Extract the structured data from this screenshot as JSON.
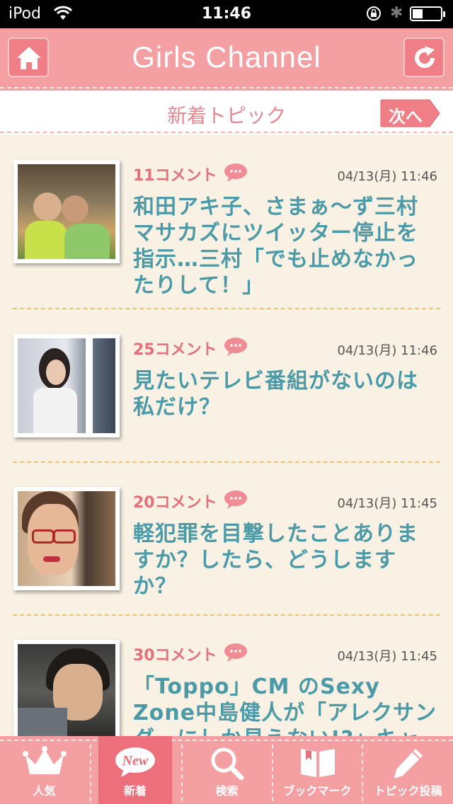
{
  "status_bar": {
    "carrier": "iPod",
    "time": "11:46"
  },
  "header": {
    "title": "Girls Channel"
  },
  "subheader": {
    "label": "新着トピック",
    "next_label": "次へ"
  },
  "topics": [
    {
      "comments": "11コメント",
      "date": "04/13(月) 11:46",
      "title": "和田アキ子、さまぁ〜ず三村マサカズにツイッター停止を指示…三村「でも止めなかったりして！」"
    },
    {
      "comments": "25コメント",
      "date": "04/13(月) 11:46",
      "title": "見たいテレビ番組がないのは私だけ？"
    },
    {
      "comments": "20コメント",
      "date": "04/13(月) 11:45",
      "title": "軽犯罪を目撃したことありますか？したら、どうしますか？"
    },
    {
      "comments": "30コメント",
      "date": "04/13(月) 11:45",
      "title": "「Toppo」CM のSexy Zone中島健人が「アレクサンダーにしか見えない!?」キャラかぶり"
    }
  ],
  "tabbar": {
    "tabs": [
      {
        "label": "人気",
        "icon": "crown-icon"
      },
      {
        "label": "新着",
        "icon": "new-badge-icon",
        "badge": "New",
        "active": true
      },
      {
        "label": "検索",
        "icon": "search-icon"
      },
      {
        "label": "ブックマーク",
        "icon": "book-icon"
      },
      {
        "label": "トピック投稿",
        "icon": "pencil-icon"
      }
    ]
  },
  "colors": {
    "header": "#f4a0a3",
    "accent": "#e3707a",
    "title_text": "#4a9aa8",
    "background": "#f8f1e4"
  }
}
